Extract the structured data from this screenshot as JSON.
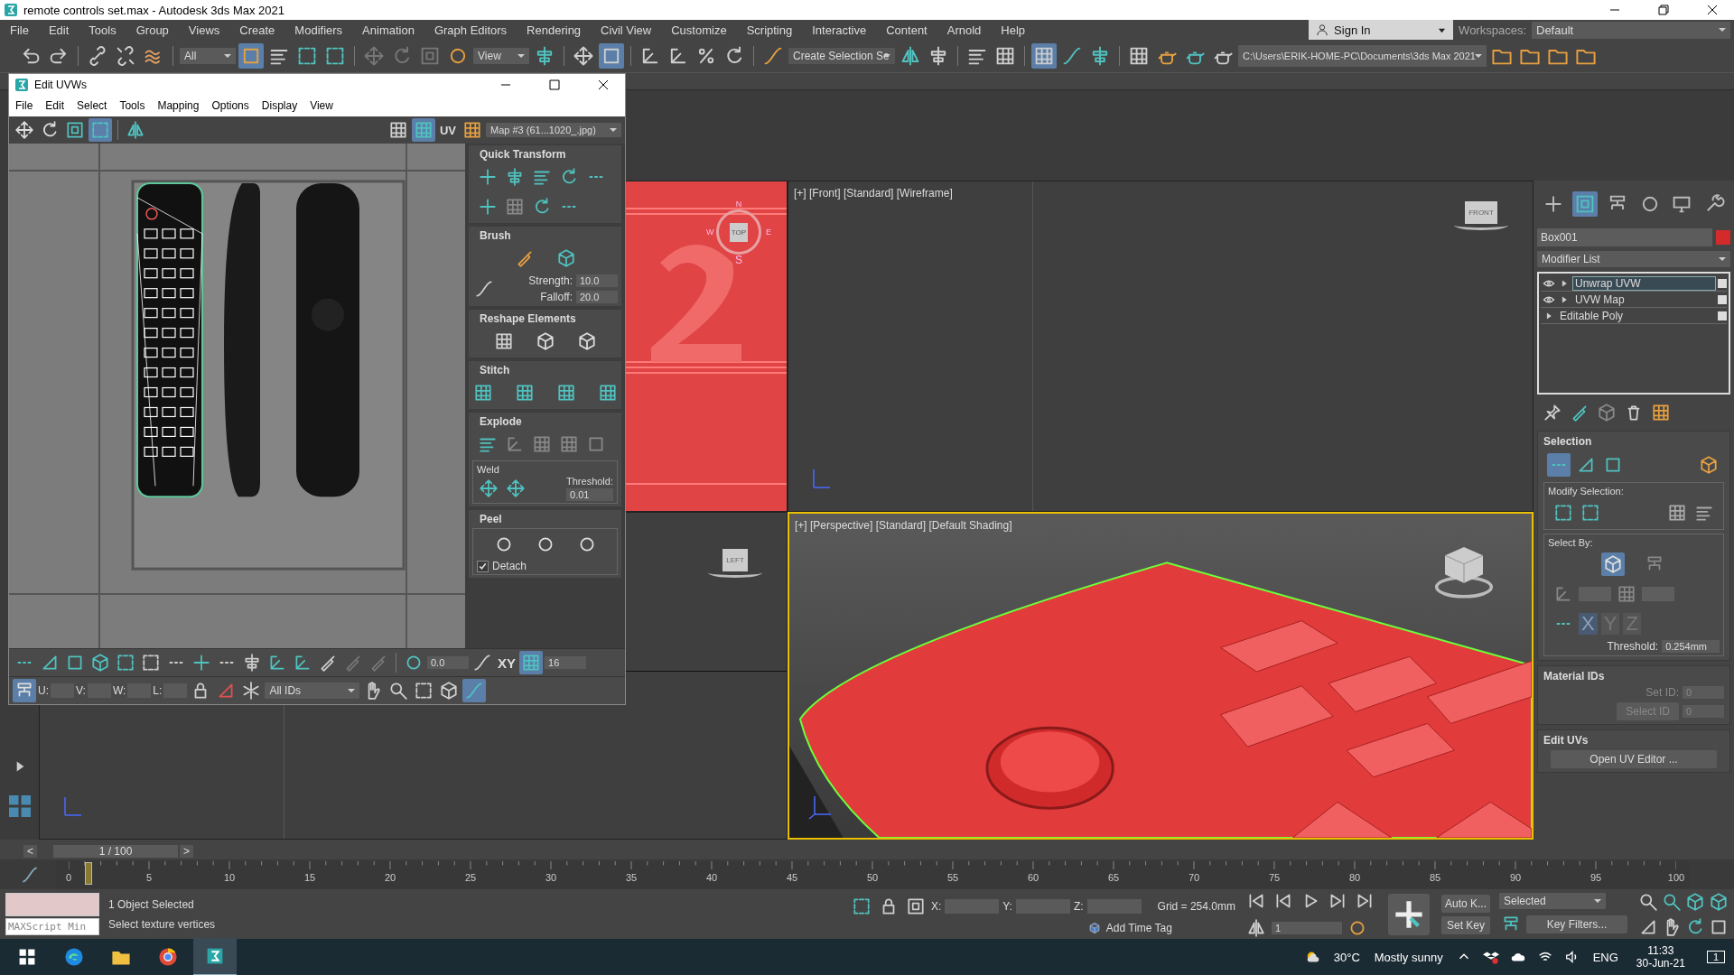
{
  "window": {
    "title": "remote controls set.max - Autodesk 3ds Max 2021"
  },
  "menu": [
    "File",
    "Edit",
    "Tools",
    "Group",
    "Views",
    "Create",
    "Modifiers",
    "Animation",
    "Graph Editors",
    "Rendering",
    "Civil View",
    "Customize",
    "Scripting",
    "Interactive",
    "Content",
    "Arnold",
    "Help"
  ],
  "account": {
    "label": "Sign In"
  },
  "workspaces": {
    "label": "Workspaces:",
    "value": "Default"
  },
  "toolbar": {
    "selection_filter": "All",
    "reference_coord": "View",
    "named_selection": "Create Selection Se",
    "project_path": "C:\\Users\\ERIK-HOME-PC\\Documents\\3ds Max 2021"
  },
  "viewports": [
    {
      "kind": "top",
      "cube": "TOP",
      "compass": [
        "N",
        "E",
        "S",
        "W"
      ],
      "active": false
    },
    {
      "kind": "front",
      "label": "[+] [Front] [Standard] [Wireframe]",
      "cube": "FRONT",
      "active": false
    },
    {
      "kind": "left",
      "cube": "LEFT",
      "active": false
    },
    {
      "kind": "perspective",
      "label": "[+] [Perspective] [Standard] [Default Shading]",
      "active": true
    }
  ],
  "edit_uvws": {
    "title": "Edit UVWs",
    "menu": [
      "File",
      "Edit",
      "Select",
      "Tools",
      "Mapping",
      "Options",
      "Display",
      "View"
    ],
    "uv_button": "UV",
    "map": "Map #3 (61...1020_.jpg)",
    "rollouts": [
      {
        "kind": "quick_transform",
        "title": "Quick Transform"
      },
      {
        "kind": "brush",
        "title": "Brush",
        "fields": [
          {
            "label": "Strength:",
            "value": "10.0"
          },
          {
            "label": "Falloff:",
            "value": "20.0"
          }
        ]
      },
      {
        "kind": "reshape",
        "title": "Reshape Elements"
      },
      {
        "kind": "stitch",
        "title": "Stitch"
      },
      {
        "kind": "explode",
        "title": "Explode",
        "weld": "Weld",
        "threshold_label": "Threshold:",
        "threshold": "0.01"
      },
      {
        "kind": "peel",
        "title": "Peel",
        "detach": {
          "label": "Detach",
          "checked": true
        }
      }
    ],
    "spin_value": "0.0",
    "axis_button": "XY",
    "grid_value": "16",
    "coords": [
      "U:",
      "V:",
      "W:",
      "L:"
    ],
    "id_filter": "All IDs"
  },
  "command_panel": {
    "tabs": [
      {
        "selected": false
      },
      {
        "selected": true
      },
      {
        "selected": false
      },
      {
        "selected": false
      },
      {
        "selected": false
      },
      {
        "selected": false
      }
    ],
    "object": {
      "name": "Box001",
      "color": "#d42a2a"
    },
    "modifier_list": "Modifier List",
    "stack": [
      {
        "name": "Unwrap UVW",
        "selected": true,
        "eye": true
      },
      {
        "name": "UVW Map",
        "selected": false,
        "eye": true
      },
      {
        "name": "Editable Poly",
        "selected": false,
        "eye": false
      }
    ],
    "selection": {
      "title": "Selection",
      "modify_label": "Modify Selection:",
      "select_by_label": "Select By:",
      "axes": [
        {
          "label": "X",
          "selected": true
        },
        {
          "label": "Y",
          "selected": false
        },
        {
          "label": "Z",
          "selected": false
        }
      ],
      "threshold_label": "Threshold:",
      "threshold": "0.254mm"
    },
    "material_ids": {
      "title": "Material IDs",
      "set_id_label": "Set ID:",
      "set_id": "0",
      "select_id_button": "Select ID",
      "select_id": "0",
      "disabled": true
    },
    "edit_uvs": {
      "title": "Edit UVs",
      "button": "Open UV Editor ..."
    }
  },
  "timeline": {
    "prev": "<",
    "frame": "1 / 100",
    "next": ">",
    "level": 0.01,
    "ticks": [
      "0",
      "5",
      "10",
      "15",
      "20",
      "25",
      "30",
      "35",
      "40",
      "45",
      "50",
      "55",
      "60",
      "65",
      "70",
      "75",
      "80",
      "85",
      "90",
      "95",
      "100"
    ]
  },
  "status": {
    "listener": "MAXScript Min",
    "selection": "1 Object Selected",
    "prompt": "Select texture vertices",
    "coords": [
      "X:",
      "Y:",
      "Z:"
    ],
    "grid": "Grid = 254.0mm",
    "time_tag": "Add Time Tag",
    "frame": "1",
    "auto_key": "Auto K...",
    "set_key": "Set Key",
    "key_mode": "Selected",
    "key_filters": "Key Filters..."
  },
  "taskbar": {
    "temperature": "30°C",
    "weather": "Mostly sunny",
    "language": "ENG",
    "time": "11:33",
    "date": "30-Jun-21",
    "notifications": "1"
  }
}
